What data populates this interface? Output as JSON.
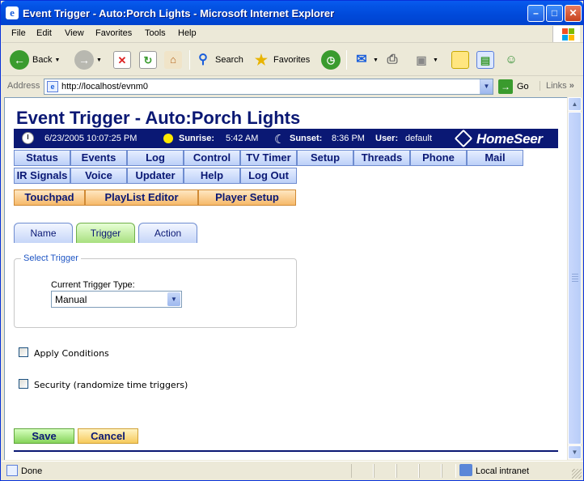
{
  "window": {
    "title": "Event Trigger - Auto:Porch Lights - Microsoft Internet Explorer",
    "controls": {
      "minimize": "–",
      "maximize": "□",
      "close": "✕"
    }
  },
  "menubar": [
    "File",
    "Edit",
    "View",
    "Favorites",
    "Tools",
    "Help"
  ],
  "toolbar": {
    "back_label": "Back",
    "search_label": "Search",
    "favorites_label": "Favorites"
  },
  "addressbar": {
    "label": "Address",
    "url": "http://localhost/evnm0",
    "go_label": "Go",
    "links_label": "Links"
  },
  "page": {
    "title": "Event Trigger - Auto:Porch Lights",
    "info": {
      "datetime": "6/23/2005 10:07:25 PM",
      "sunrise_label": "Sunrise:",
      "sunrise_value": "5:42 AM",
      "sunset_label": "Sunset:",
      "sunset_value": "8:36 PM",
      "user_label": "User:",
      "user_value": "default",
      "logo": "HomeSeer"
    },
    "nav_row1": [
      "Status",
      "Events",
      "Log",
      "Control",
      "TV Timer",
      "Setup",
      "Threads",
      "Phone",
      "Mail"
    ],
    "nav_row2": [
      "IR Signals",
      "Voice",
      "Updater",
      "Help",
      "Log Out"
    ],
    "nav_row3": [
      "Touchpad",
      "PlayList Editor",
      "Player Setup"
    ],
    "tabs": [
      "Name",
      "Trigger",
      "Action"
    ],
    "active_tab": "Trigger",
    "select_trigger": {
      "legend": "Select Trigger",
      "label": "Current Trigger Type:",
      "value": "Manual"
    },
    "apply_conditions_label": "Apply Conditions",
    "security_label": "Security (randomize time triggers)",
    "save_label": "Save",
    "cancel_label": "Cancel"
  },
  "statusbar": {
    "status": "Done",
    "zone": "Local intranet"
  },
  "colors": {
    "titlebar": "#0049D9",
    "page_title": "#0A1874",
    "info_bar": "#0A1874",
    "nav_blue": "#BCD0F8",
    "nav_orange": "#F6B96A",
    "save": "#86D45A",
    "cancel": "#F6CA5C"
  }
}
